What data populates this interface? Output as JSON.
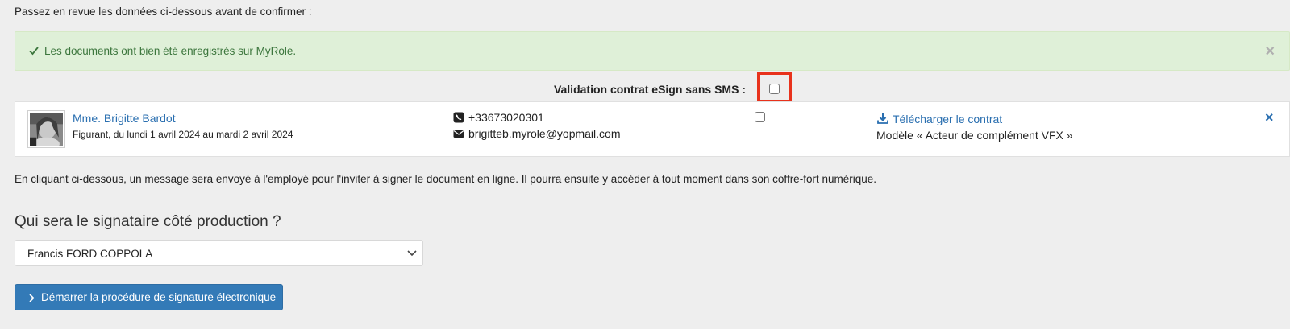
{
  "intro_text": "Passez en revue les données ci-dessous avant de confirmer :",
  "alert": {
    "message": "Les documents ont bien été enregistrés sur MyRole.",
    "close_symbol": "×"
  },
  "validation": {
    "label": "Validation contrat eSign sans SMS :",
    "checked": false
  },
  "employee": {
    "name": "Mme. Brigitte Bardot",
    "period": "Figurant, du lundi 1 avril 2024 au mardi 2 avril 2024",
    "phone": "+33673020301",
    "email": "brigitteb.myrole@yopmail.com",
    "checked": false,
    "download_label": "Télécharger le contrat",
    "model": "Modèle « Acteur de complément VFX »",
    "remove_symbol": "×"
  },
  "info_text": "En cliquant ci-dessous, un message sera envoyé à l'employé pour l'inviter à signer le document en ligne. Il pourra ensuite y accéder à tout moment dans son coffre-fort numérique.",
  "signatory": {
    "question": "Qui sera le signataire côté production ?",
    "selected": "Francis FORD COPPOLA"
  },
  "start_button_label": "Démarrer la procédure de signature électronique",
  "colors": {
    "link": "#2a6fb0",
    "success_bg": "#dff0d8",
    "success_text": "#3c763d",
    "primary": "#337ab7",
    "highlight": "#e8321c"
  },
  "icons": [
    "check-icon",
    "close-icon",
    "phone-icon",
    "envelope-icon",
    "download-icon",
    "chevron-down-icon",
    "chevron-right-icon"
  ]
}
